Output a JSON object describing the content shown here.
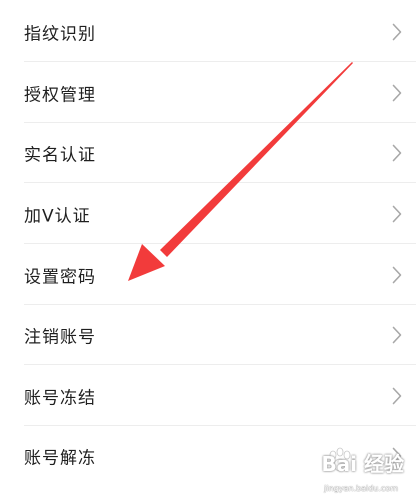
{
  "settings_list": {
    "items": [
      {
        "label": "指纹识别"
      },
      {
        "label": "授权管理"
      },
      {
        "label": "实名认证"
      },
      {
        "label": "加V认证"
      },
      {
        "label": "设置密码"
      },
      {
        "label": "注销账号"
      },
      {
        "label": "账号冻结"
      },
      {
        "label": "账号解冻"
      }
    ]
  },
  "annotation": {
    "arrow_color": "#f23b3b"
  },
  "watermark": {
    "brand": "Bai 经验",
    "url": "jingyan.baidu.com"
  },
  "colors": {
    "background": "#ffffff",
    "text": "#1f1f1f",
    "chevron": "#a8a8a8",
    "divider": "#ededed"
  }
}
